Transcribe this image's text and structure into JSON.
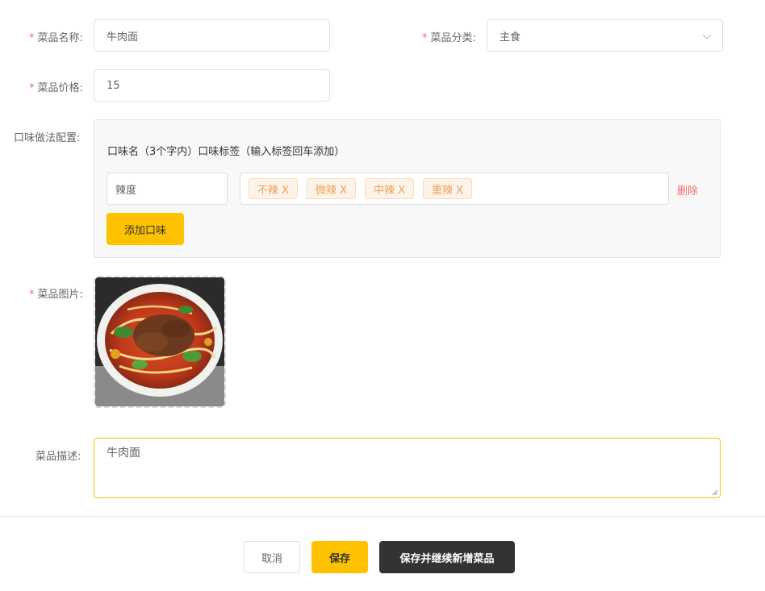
{
  "form": {
    "name": {
      "label": "菜品名称:",
      "value": "牛肉面",
      "required": true
    },
    "category": {
      "label": "菜品分类:",
      "value": "主食",
      "required": true
    },
    "price": {
      "label": "菜品价格:",
      "value": "15",
      "required": true
    },
    "flavor": {
      "label": "口味做法配置:",
      "header": "口味名（3个字内）口味标签（输入标签回车添加）",
      "name_value": "辣度",
      "tags": [
        "不辣 X",
        "微辣 X",
        "中辣 X",
        "重辣 X"
      ],
      "delete_label": "删除",
      "add_label": "添加口味"
    },
    "image": {
      "label": "菜品图片:",
      "required": true,
      "icon": "dish-photo-beef-noodles"
    },
    "description": {
      "label": "菜品描述:",
      "value": "牛肉面"
    }
  },
  "required_mark": "*",
  "actions": {
    "cancel_label": "取消",
    "save_label": "保存",
    "save_continue_label": "保存并继续新增菜品"
  },
  "colors": {
    "accent": "#ffc200",
    "required": "#f56c6c",
    "tag_text": "#f0a05a",
    "tag_bg": "#fdf3e8",
    "dark_button": "#333333"
  }
}
